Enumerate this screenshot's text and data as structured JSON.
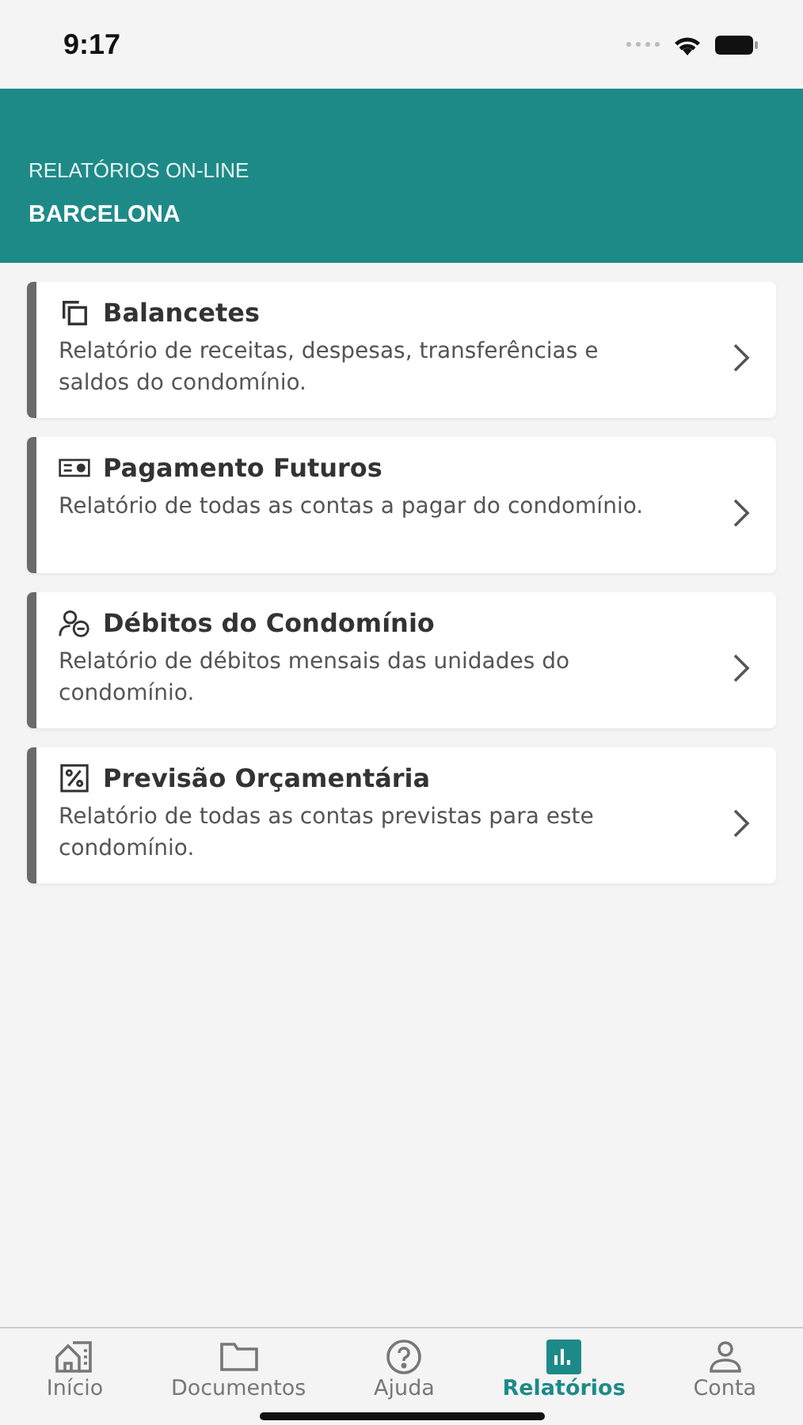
{
  "status_bar": {
    "time": "9:17"
  },
  "header": {
    "subtitle": "RELATÓRIOS ON-LINE",
    "title": "BARCELONA"
  },
  "reports": [
    {
      "title": "Balancetes",
      "description": "Relatório de receitas, despesas, transferências e saldos do condomínio."
    },
    {
      "title": "Pagamento Futuros",
      "description": "Relatório de todas as contas a pagar do condomínio."
    },
    {
      "title": "Débitos do Condomínio",
      "description": "Relatório de débitos mensais das unidades do condomínio."
    },
    {
      "title": "Previsão Orçamentária",
      "description": "Relatório de todas as contas previstas para este condomínio."
    }
  ],
  "tab_bar": [
    {
      "label": "Início",
      "selected": false
    },
    {
      "label": "Documentos",
      "selected": false
    },
    {
      "label": "Ajuda",
      "selected": false
    },
    {
      "label": "Relatórios",
      "selected": true
    },
    {
      "label": "Conta",
      "selected": false
    }
  ]
}
